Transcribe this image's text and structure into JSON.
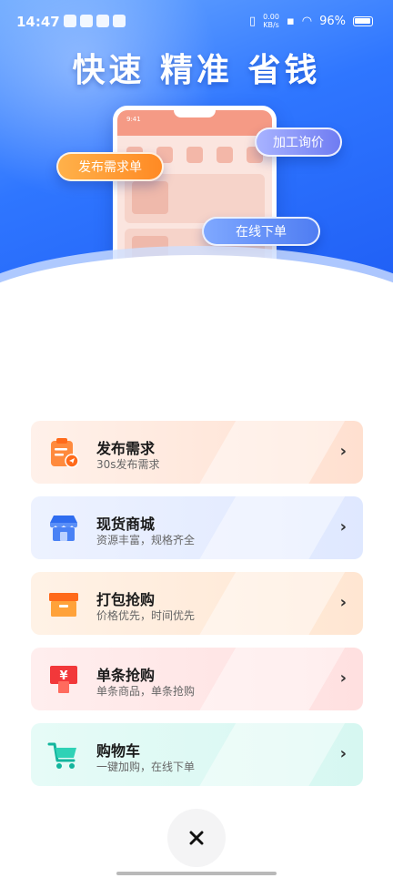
{
  "status_bar": {
    "time": "14:47",
    "net_speed_value": "0.00",
    "net_speed_unit": "KB/s",
    "battery_percent": "96%"
  },
  "hero": {
    "title": "快速 精准 省钱",
    "phone_time": "9:41",
    "bubble_publish": "发布需求单",
    "bubble_inquiry": "加工询价",
    "bubble_order": "在线下单"
  },
  "menu": {
    "items": [
      {
        "title": "发布需求",
        "subtitle": "30s发布需求",
        "icon": "clipboard-send-icon",
        "accent": "#ff7a2e"
      },
      {
        "title": "现货商城",
        "subtitle": "资源丰富，规格齐全",
        "icon": "store-icon",
        "accent": "#3f7bf5"
      },
      {
        "title": "打包抢购",
        "subtitle": "价格优先，时间优先",
        "icon": "box-icon",
        "accent": "#ff8a1f"
      },
      {
        "title": "单条抢购",
        "subtitle": "单条商品，单条抢购",
        "icon": "yen-tag-icon",
        "accent": "#f2383a"
      },
      {
        "title": "购物车",
        "subtitle": "一键加购，在线下单",
        "icon": "cart-icon",
        "accent": "#1fbfa8"
      }
    ],
    "chevron": "›"
  },
  "close": {
    "icon": "close-icon"
  }
}
